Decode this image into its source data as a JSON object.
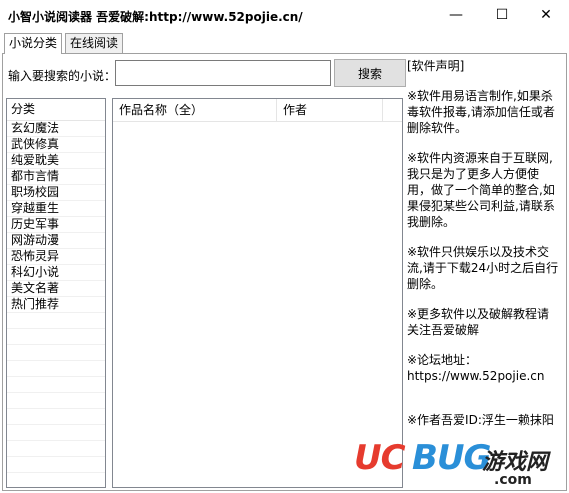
{
  "window": {
    "title": "小智小说阅读器  吾爱破解:http://www.52pojie.cn/",
    "minimize_glyph": "—",
    "maximize_glyph": "☐",
    "close_glyph": "✕"
  },
  "tabs": [
    {
      "label": "小说分类",
      "active": true
    },
    {
      "label": "在线阅读",
      "active": false
    }
  ],
  "search": {
    "label": "输入要搜索的小说：",
    "value": "",
    "button_label": "搜索"
  },
  "categories": {
    "header": "分类",
    "items": [
      "玄幻魔法",
      "武侠修真",
      "纯爱耽美",
      "都市言情",
      "职场校园",
      "穿越重生",
      "历史军事",
      "网游动漫",
      "恐怖灵异",
      "科幻小说",
      "美文名著",
      "热门推荐"
    ]
  },
  "works": {
    "columns": [
      "作品名称（全）",
      "作者"
    ]
  },
  "notes": {
    "title": "[软件声明]",
    "p1": "※软件用易语言制作,如果杀毒软件报毒,请添加信任或者删除软件。",
    "p2": "※软件内资源来自于互联网,我只是为了更多人方便使用，做了一个简单的整合,如果侵犯某些公司利益,请联系我删除。",
    "p3": "※软件只供娱乐以及技术交流,请于下载24小时之后自行删除。",
    "p4": "※更多软件以及破解教程请关注吾爱破解",
    "p5_label": "※论坛地址：",
    "p5_url": "https://www.52pojie.cn",
    "p6": "※作者吾爱ID:浮生一赖抹阳光"
  },
  "watermark": {
    "uc": "UC",
    "bug": "BUG",
    "cn": "游戏网",
    "com": ".com"
  },
  "colors": {
    "watermark_red": "#e63b2e",
    "watermark_blue": "#2a8fd8"
  }
}
